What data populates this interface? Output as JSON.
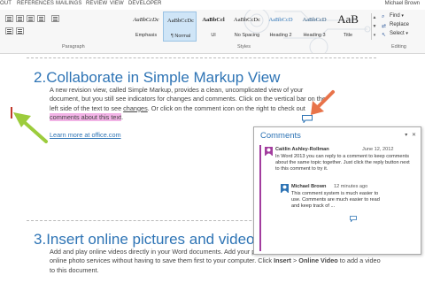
{
  "ribbon": {
    "tabs": [
      "OUT",
      "REFERENCES",
      "MAILINGS",
      "REVIEW",
      "VIEW",
      "DEVELOPER"
    ],
    "user_name": "Michael Brown",
    "group_labels": {
      "paragraph": "Paragraph",
      "styles": "Styles",
      "editing": "Editing"
    },
    "styles": [
      {
        "sample": "AaBbCcDc",
        "name": "Emphasis"
      },
      {
        "sample": "AaBbCcDc",
        "name": "¶ Normal"
      },
      {
        "sample": "AaBbCcl",
        "name": "Ul"
      },
      {
        "sample": "AaBbCcDc",
        "name": "No Spacing"
      },
      {
        "sample": "AaBbCcD",
        "name": "Heading 2"
      },
      {
        "sample": "AaBbCcD",
        "name": "Heading 3"
      },
      {
        "sample": "AaB",
        "name": "Title"
      }
    ],
    "editing": {
      "find": "Find",
      "replace": "Replace",
      "select": "Select"
    }
  },
  "document": {
    "section2": {
      "number": "2.",
      "title": "Collaborate in Simple Markup View",
      "text_before": "A new revision view, called Simple Markup, provides a clean, uncomplicated view of your document, but you still see indicators for changes and comments. Click on the vertical bar on the left side of the text to see ",
      "changes_word": "changes",
      "text_mid": ". Or click on the comment icon on the right to check out ",
      "highlighted": "comments about this text",
      "text_end": ".",
      "link": "Learn more at office.com"
    },
    "section3": {
      "number": "3.",
      "title": "Insert online pictures and video",
      "text_before": "Add and play online videos directly in your Word documents. Add your pictures from Facebook, Flickr and other online photo services without having to save them first to your computer. Click ",
      "insert": "Insert",
      "sep": " > ",
      "online_video": "Online Video",
      "text_end": " to add a video to this document."
    }
  },
  "comments_pane": {
    "title": "Comments",
    "comments": [
      {
        "author": "Caitlin Ashley-Rollman",
        "date": "June 12, 2012",
        "text": "In Word 2013 you can reply to a comment to keep comments about the same topic together. Just click the reply button next to this comment to try it."
      },
      {
        "author": "Michael Brown",
        "date": "12 minutes ago",
        "text": "This comment system is much easier to use. Comments are much easier to read and keep track of ..."
      }
    ]
  },
  "colors": {
    "heading": "#2e74b5",
    "highlight": "#f2b3e6",
    "change_bar": "#c0392b",
    "arrow_green": "#9ccc3c",
    "arrow_orange": "#e8734a",
    "comment_accent": "#a23d9e"
  }
}
